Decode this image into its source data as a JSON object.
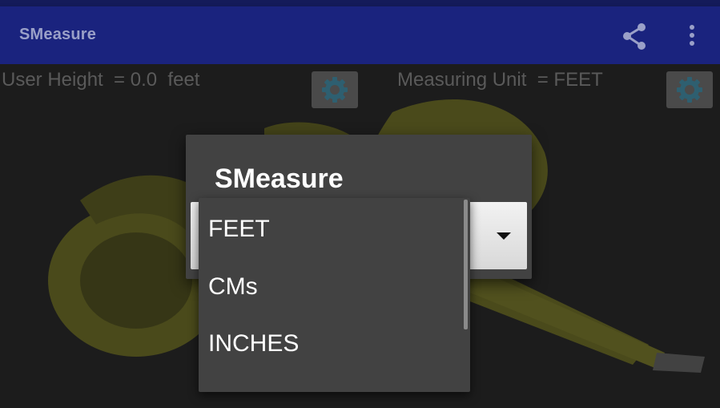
{
  "app_bar": {
    "title": "SMeasure",
    "share_icon": "share-icon",
    "more_icon": "more-vert-icon",
    "background": "#1a237e"
  },
  "main": {
    "user_height_text": "User Height  = 0.0  feet",
    "measuring_unit_text": "Measuring Unit  = FEET",
    "settings_icon": "gear-icon",
    "background_image": "measuring-tape"
  },
  "dialog": {
    "title": "SMeasure",
    "spinner_icon": "dropdown-arrow-icon"
  },
  "dropdown": {
    "options": [
      "FEET",
      "CMs",
      "INCHES"
    ]
  }
}
